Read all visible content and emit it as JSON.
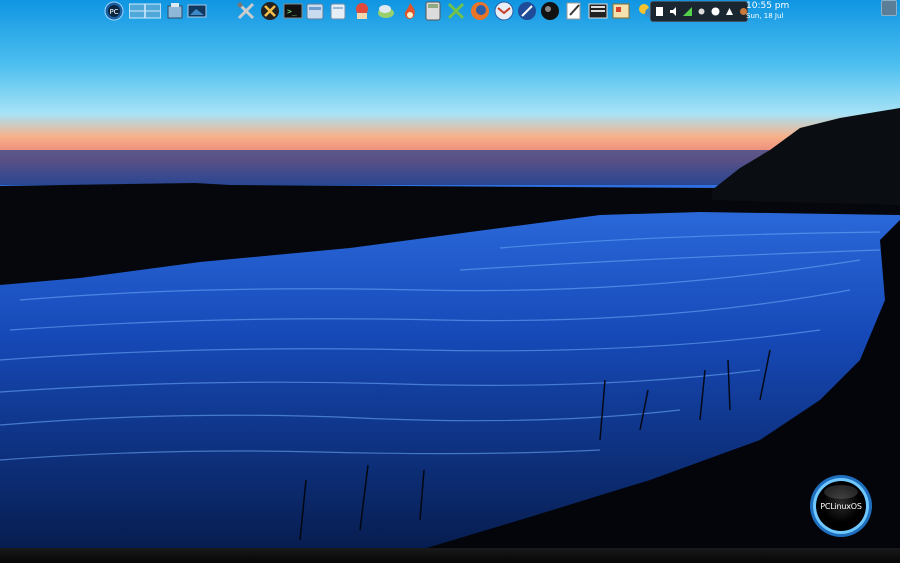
{
  "panel": {
    "launchers": [
      {
        "icon": "pclinuxos-menu-icon"
      },
      {
        "icon": "virtual-desktop-pager-icon"
      },
      {
        "icon": "home-folder-icon"
      },
      {
        "icon": "show-desktop-icon"
      },
      {
        "icon": "system-tools-icon"
      },
      {
        "icon": "control-center-icon"
      },
      {
        "icon": "terminal-icon"
      },
      {
        "icon": "file-manager-icon"
      },
      {
        "icon": "package-manager-icon"
      },
      {
        "icon": "games-icon"
      },
      {
        "icon": "network-icon"
      },
      {
        "icon": "flame-icon"
      },
      {
        "icon": "calculator-icon"
      },
      {
        "icon": "tools-icon"
      },
      {
        "icon": "firefox-icon"
      },
      {
        "icon": "email-client-icon"
      },
      {
        "icon": "music-player-icon"
      },
      {
        "icon": "media-player-icon"
      },
      {
        "icon": "text-editor-icon"
      },
      {
        "icon": "video-player-icon"
      },
      {
        "icon": "image-viewer-icon"
      },
      {
        "icon": "chat-icon"
      }
    ],
    "tray": [
      {
        "icon": "clipboard-icon"
      },
      {
        "icon": "volume-icon"
      },
      {
        "icon": "network-signal-icon"
      },
      {
        "icon": "update-notifier-icon"
      },
      {
        "icon": "power-icon"
      },
      {
        "icon": "battery-icon"
      },
      {
        "icon": "mixer-icon"
      }
    ],
    "clock": {
      "time": "10:55 pm",
      "date": "Sun, 18 Jul"
    }
  },
  "logo": {
    "text": "PCLinuxOS"
  },
  "colors": {
    "sky_top": "#1aa0e6",
    "sky_mid": "#7ad6f4",
    "sunset": "#f08a6a",
    "water": "#1650c8",
    "shore": "#05070a"
  }
}
